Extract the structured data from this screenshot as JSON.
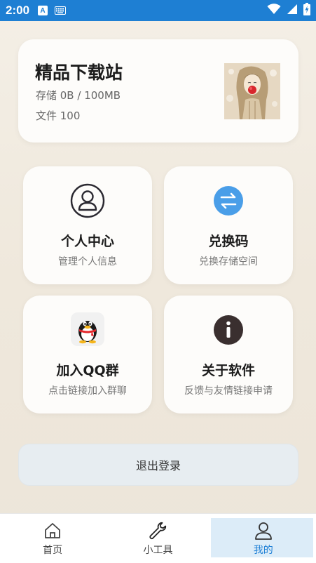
{
  "status_bar": {
    "time": "2:00",
    "notification_icons": [
      "a-icon",
      "keyboard-icon"
    ],
    "system_icons": [
      "wifi-icon",
      "signal-icon",
      "battery-charging-icon"
    ],
    "color": "#1e7fd3"
  },
  "profile": {
    "title": "精品下载站",
    "storage": "存储 0B / 100MB",
    "files": "文件 100"
  },
  "tiles": [
    {
      "title": "个人中心",
      "subtitle": "管理个人信息",
      "icon": "user-icon"
    },
    {
      "title": "兑换码",
      "subtitle": "兑换存储空间",
      "icon": "exchange-icon",
      "icon_color": "#4a9ee8"
    },
    {
      "title": "加入QQ群",
      "subtitle": "点击链接加入群聊",
      "icon": "qq-penguin-icon"
    },
    {
      "title": "关于软件",
      "subtitle": "反馈与友情链接申请",
      "icon": "info-icon",
      "icon_color": "#3a2f2f"
    }
  ],
  "logout_label": "退出登录",
  "bottom_nav": {
    "items": [
      {
        "label": "首页",
        "icon": "home-icon"
      },
      {
        "label": "小工具",
        "icon": "wrench-icon"
      },
      {
        "label": "我的",
        "icon": "person-icon",
        "active": true
      }
    ],
    "active_color": "#1f80d6"
  }
}
